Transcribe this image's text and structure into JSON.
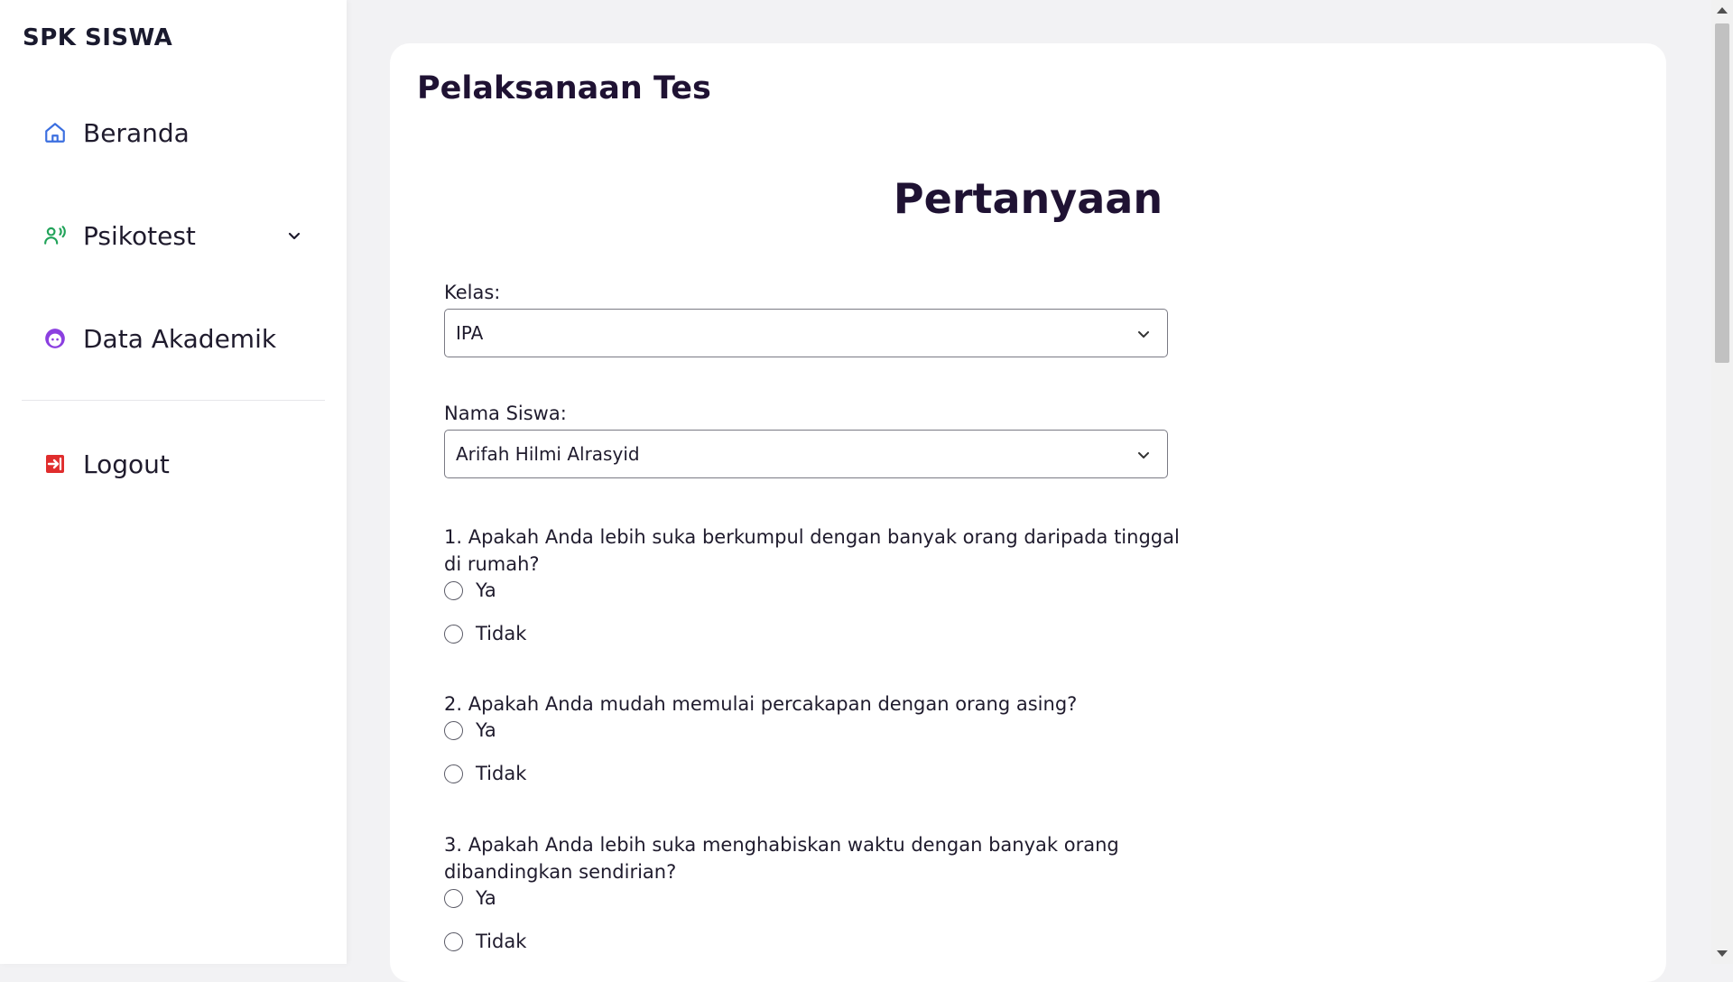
{
  "sidebar": {
    "brand": "SPK SISWA",
    "items": [
      {
        "label": "Beranda",
        "icon": "home-icon",
        "color": "#3b6fe0"
      },
      {
        "label": "Psikotest",
        "icon": "users-voice-icon",
        "color": "#22a35a"
      },
      {
        "label": "Data Akademik",
        "icon": "face-icon",
        "color": "#8b3fe0"
      },
      {
        "label": "Logout",
        "icon": "logout-icon",
        "color": "#e02d2d"
      }
    ]
  },
  "main": {
    "page_title": "Pelaksanaan Tes",
    "section_title": "Pertanyaan",
    "kelas": {
      "label": "Kelas:",
      "value": "IPA"
    },
    "nama_siswa": {
      "label": "Nama Siswa:",
      "value": "Arifah Hilmi Alrasyid"
    },
    "questions": [
      {
        "text": "1. Apakah Anda lebih suka berkumpul dengan banyak orang daripada tinggal di rumah?",
        "options": [
          "Ya",
          "Tidak"
        ]
      },
      {
        "text": "2. Apakah Anda mudah memulai percakapan dengan orang asing?",
        "options": [
          "Ya",
          "Tidak"
        ]
      },
      {
        "text": "3. Apakah Anda lebih suka menghabiskan waktu dengan banyak orang dibandingkan sendirian?",
        "options": [
          "Ya",
          "Tidak"
        ]
      }
    ]
  }
}
